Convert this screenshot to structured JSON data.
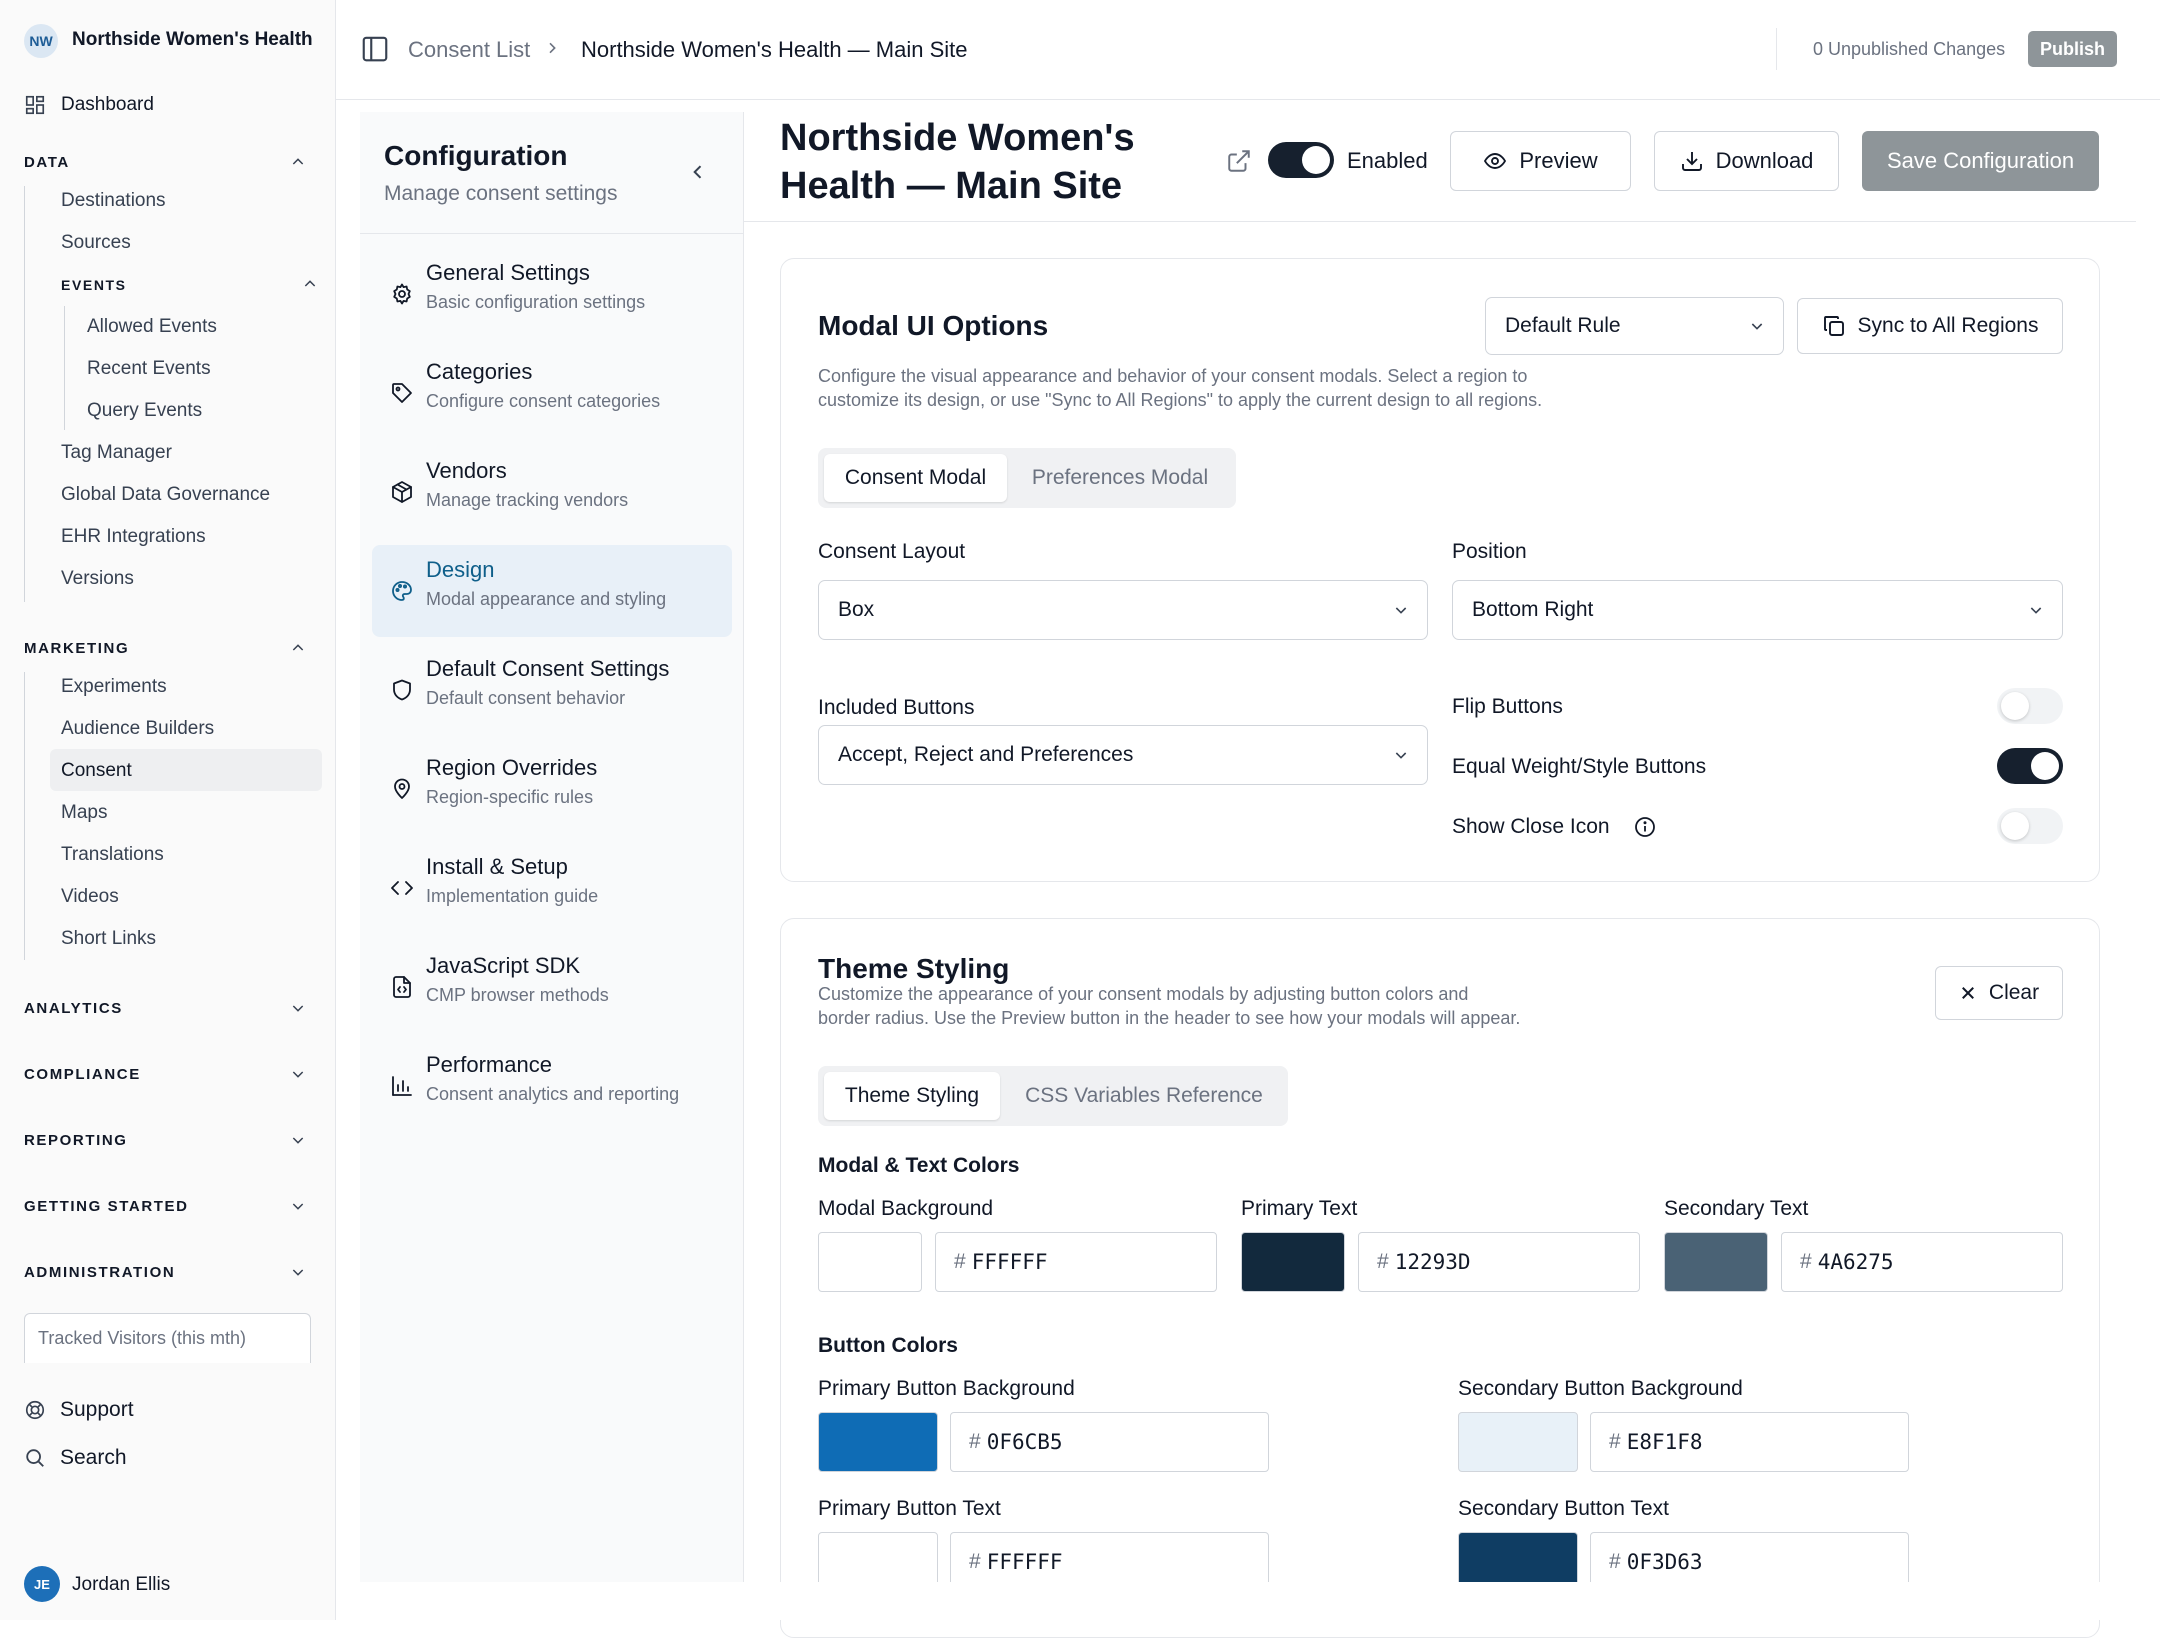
{
  "workspace": {
    "initials": "NW",
    "name": "Northside Women's Health"
  },
  "sidebar": {
    "dashboard": "Dashboard",
    "data": {
      "title": "DATA",
      "items": [
        "Destinations",
        "Sources"
      ],
      "events": {
        "title": "EVENTS",
        "items": [
          "Allowed Events",
          "Recent Events",
          "Query Events"
        ]
      },
      "items_after": [
        "Tag Manager",
        "Global Data Governance",
        "EHR Integrations",
        "Versions"
      ]
    },
    "marketing": {
      "title": "MARKETING",
      "items": [
        "Experiments",
        "Audience Builders",
        "Consent",
        "Maps",
        "Translations",
        "Videos",
        "Short Links"
      ]
    },
    "collapsed_sections": [
      "ANALYTICS",
      "COMPLIANCE",
      "REPORTING",
      "GETTING STARTED",
      "ADMINISTRATION"
    ],
    "tracked_label": "Tracked Visitors (this mth)",
    "support": "Support",
    "search": "Search",
    "user": {
      "initials": "JE",
      "name": "Jordan Ellis"
    }
  },
  "topbar": {
    "breadcrumb_parent": "Consent List",
    "breadcrumb_current": "Northside Women's Health — Main Site",
    "unpublished": "0 Unpublished Changes",
    "publish": "Publish"
  },
  "config": {
    "title": "Configuration",
    "subtitle": "Manage consent settings",
    "items": [
      {
        "title": "General Settings",
        "sub": "Basic configuration settings",
        "icon": "gear-icon"
      },
      {
        "title": "Categories",
        "sub": "Configure consent categories",
        "icon": "tag-icon"
      },
      {
        "title": "Vendors",
        "sub": "Manage tracking vendors",
        "icon": "package-icon"
      },
      {
        "title": "Design",
        "sub": "Modal appearance and styling",
        "icon": "palette-icon"
      },
      {
        "title": "Default Consent Settings",
        "sub": "Default consent behavior",
        "icon": "shield-icon"
      },
      {
        "title": "Region Overrides",
        "sub": "Region-specific rules",
        "icon": "map-pin-icon"
      },
      {
        "title": "Install & Setup",
        "sub": "Implementation guide",
        "icon": "code-icon"
      },
      {
        "title": "JavaScript SDK",
        "sub": "CMP browser methods",
        "icon": "file-code-icon"
      },
      {
        "title": "Performance",
        "sub": "Consent analytics and reporting",
        "icon": "bar-chart-icon"
      }
    ],
    "active_index": 3
  },
  "header": {
    "site_title_line1": "Northside Women's",
    "site_title_line2": "Health — Main Site",
    "enabled_label": "Enabled",
    "enabled": true,
    "preview": "Preview",
    "download": "Download",
    "save": "Save Configuration"
  },
  "modal_ui": {
    "title": "Modal UI Options",
    "rule_select": "Default Rule",
    "sync_button": "Sync to All Regions",
    "description_line1": "Configure the visual appearance and behavior of your consent modals. Select a region to",
    "description_line2": "customize its design, or use \"Sync to All Regions\" to apply the current design to all regions.",
    "tabs": [
      "Consent Modal",
      "Preferences Modal"
    ],
    "consent_layout_label": "Consent Layout",
    "consent_layout_value": "Box",
    "position_label": "Position",
    "position_value": "Bottom Right",
    "included_buttons_label": "Included Buttons",
    "included_buttons_value": "Accept, Reject and Preferences",
    "flip_buttons_label": "Flip Buttons",
    "flip_buttons": false,
    "equal_weight_label": "Equal Weight/Style Buttons",
    "equal_weight": true,
    "show_close_label": "Show Close Icon",
    "show_close": false
  },
  "theme": {
    "title": "Theme Styling",
    "description_line1": "Customize the appearance of your consent modals by adjusting button colors and",
    "description_line2": "border radius. Use the Preview button in the header to see how your modals will appear.",
    "clear": "Clear",
    "tabs": [
      "Theme Styling",
      "CSS Variables Reference"
    ],
    "modal_text_heading": "Modal & Text Colors",
    "modal_bg_label": "Modal Background",
    "modal_bg": "FFFFFF",
    "primary_text_label": "Primary Text",
    "primary_text": "12293D",
    "secondary_text_label": "Secondary Text",
    "secondary_text": "4A6275",
    "button_colors_heading": "Button Colors",
    "primary_btn_bg_label": "Primary Button Background",
    "primary_btn_bg": "0F6CB5",
    "secondary_btn_bg_label": "Secondary Button Background",
    "secondary_btn_bg": "E8F1F8",
    "primary_btn_text_label": "Primary Button Text",
    "primary_btn_text": "FFFFFF",
    "secondary_btn_text_label": "Secondary Button Text",
    "secondary_btn_text": "0F3D63",
    "hash": "#"
  },
  "colors": {
    "accent_badge": "#dbe7f3",
    "avatar": "#1d6fb8",
    "active_item": "#e8f0f8",
    "save_button": "#8e9599",
    "publish_button": "#8e9599",
    "toggle_on": "#16202e"
  }
}
